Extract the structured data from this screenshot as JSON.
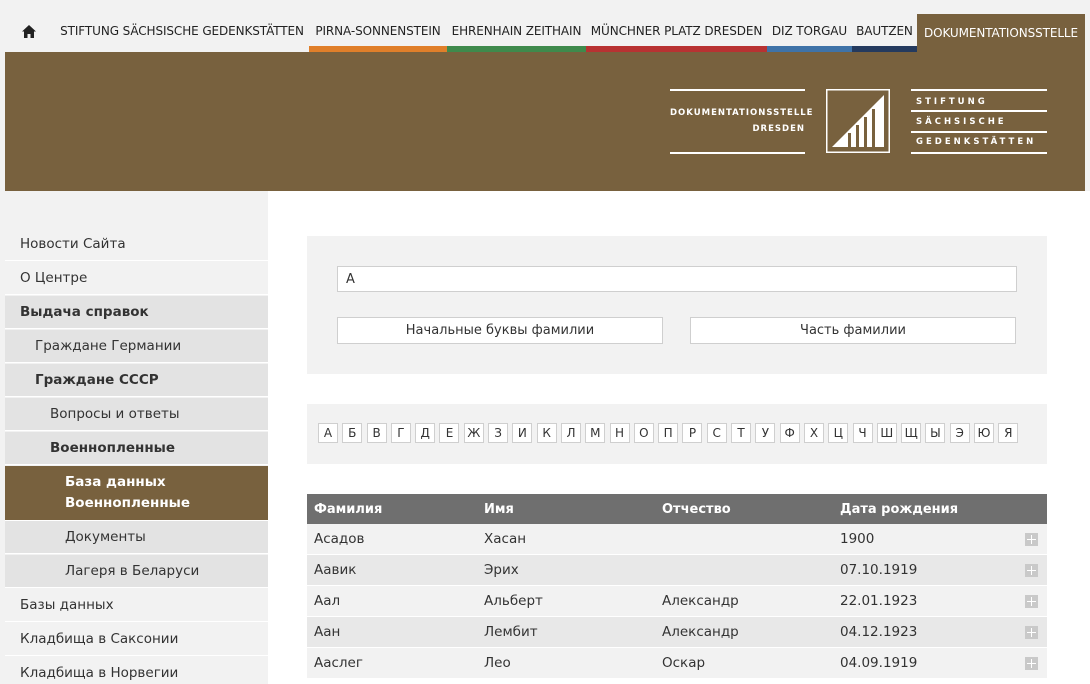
{
  "nav": {
    "items": [
      {
        "label": "STIFTUNG SÄCHSISCHE GEDENKSTÄTTEN",
        "color": "#f2f2f2"
      },
      {
        "label": "PIRNA-SONNENSTEIN",
        "color": "#e07f2a"
      },
      {
        "label": "EHRENHAIN ZEITHAIN",
        "color": "#3f8a4c"
      },
      {
        "label": "MÜNCHNER PLATZ DRESDEN",
        "color": "#b83232"
      },
      {
        "label": "DIZ TORGAU",
        "color": "#3f73a8"
      },
      {
        "label": "BAUTZEN",
        "color": "#243a5e"
      },
      {
        "label": "DOKUMENTATIONSSTELLE",
        "color": "#78613e"
      }
    ]
  },
  "logo": {
    "left_line1": "DOKUMENTATIONSSTELLE",
    "left_line2": "DRESDEN",
    "right_line1": "STIFTUNG",
    "right_line2": "SÄCHSISCHE",
    "right_line3": "GEDENKSTÄTTEN"
  },
  "sidebar": {
    "items": [
      {
        "label": "Новости Сайта"
      },
      {
        "label": "О Центре"
      },
      {
        "label": "Выдача справок"
      },
      {
        "label": "Граждане Германии"
      },
      {
        "label": "Граждане СССР"
      },
      {
        "label": "Вопросы и ответы"
      },
      {
        "label": "Военнопленные"
      },
      {
        "label": "База данных Военнопленные"
      },
      {
        "label": "Документы"
      },
      {
        "label": "Лагеря в Беларуси"
      },
      {
        "label": "Базы данных"
      },
      {
        "label": "Кладбища в Саксонии"
      },
      {
        "label": "Кладбища в Норвегии"
      }
    ]
  },
  "search": {
    "value": "А",
    "btn_initial": "Начальные буквы фамилии",
    "btn_part": "Часть фамилии"
  },
  "alphabet": [
    "А",
    "Б",
    "В",
    "Г",
    "Д",
    "Е",
    "Ж",
    "З",
    "И",
    "К",
    "Л",
    "М",
    "Н",
    "О",
    "П",
    "Р",
    "С",
    "Т",
    "У",
    "Ф",
    "Х",
    "Ц",
    "Ч",
    "Ш",
    "Щ",
    "Ы",
    "Э",
    "Ю",
    "Я"
  ],
  "table": {
    "headers": [
      "Фамилия",
      "Имя",
      "Отчество",
      "Дата рождения"
    ],
    "rows": [
      [
        "Асадов",
        "Хасан",
        "",
        "1900"
      ],
      [
        "Аавик",
        "Эрих",
        "",
        "07.10.1919"
      ],
      [
        "Аал",
        "Альберт",
        "Александр",
        "22.01.1923"
      ],
      [
        "Аан",
        "Лембит",
        "Александр",
        "04.12.1923"
      ],
      [
        "Ааслег",
        "Лео",
        "Оскар",
        "04.09.1919"
      ]
    ]
  }
}
